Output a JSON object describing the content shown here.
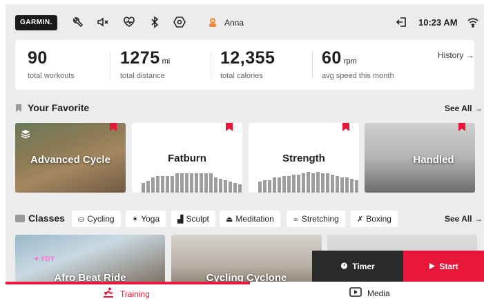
{
  "colors": {
    "accent": "#e8173a",
    "dark": "#2a2a2a",
    "background": "#ececec"
  },
  "topbar": {
    "logo": "GARMIN.",
    "icons": [
      "tools-icon",
      "mute-icon",
      "heart-rate-icon",
      "bluetooth-icon",
      "settings-icon"
    ],
    "user_name": "Anna",
    "time": "10:23 AM"
  },
  "stats": {
    "workouts": {
      "value": "90",
      "unit": "",
      "label": "total workouts"
    },
    "distance": {
      "value": "1275",
      "unit": "mi",
      "label": "total distance"
    },
    "calories": {
      "value": "12,355",
      "unit": "",
      "label": "total calories"
    },
    "speed": {
      "value": "60",
      "unit": "rpm",
      "label": "avg speed this month"
    },
    "history_label": "History →"
  },
  "favorites": {
    "title": "Your Favorite",
    "see_all": "See All →",
    "cards": [
      {
        "title": "Advanced Cycle"
      },
      {
        "title": "Fatburn",
        "bars": [
          0.35,
          0.42,
          0.55,
          0.6,
          0.6,
          0.6,
          0.6,
          0.7,
          0.7,
          0.7,
          0.7,
          0.7,
          0.7,
          0.7,
          0.7,
          0.55,
          0.5,
          0.45,
          0.4,
          0.35,
          0.3,
          0.3
        ]
      },
      {
        "title": "Strength",
        "bars": [
          0.4,
          0.45,
          0.45,
          0.55,
          0.55,
          0.6,
          0.6,
          0.65,
          0.65,
          0.7,
          0.75,
          0.7,
          0.75,
          0.7,
          0.7,
          0.65,
          0.6,
          0.55,
          0.55,
          0.5,
          0.45,
          0.45
        ]
      },
      {
        "title": "Handled"
      }
    ]
  },
  "classes": {
    "title": "Classes",
    "see_all": "See All →",
    "chips": [
      {
        "icon": "⛀",
        "label": "Cycling"
      },
      {
        "icon": "✶",
        "label": "Yoga"
      },
      {
        "icon": "▟",
        "label": "Sculpt"
      },
      {
        "icon": "⏏",
        "label": "Meditation"
      },
      {
        "icon": "⌯",
        "label": "Stretching"
      },
      {
        "icon": "✗",
        "label": "Boxing"
      }
    ],
    "cards": [
      {
        "title": "Afro Beat Ride",
        "badge": "♥ YDY"
      },
      {
        "title": "Cycling Cyclone"
      },
      {
        "title": ""
      }
    ]
  },
  "actions": {
    "timer": "Timer",
    "start": "Start"
  },
  "bottomnav": {
    "training": "Training",
    "media": "Media"
  }
}
